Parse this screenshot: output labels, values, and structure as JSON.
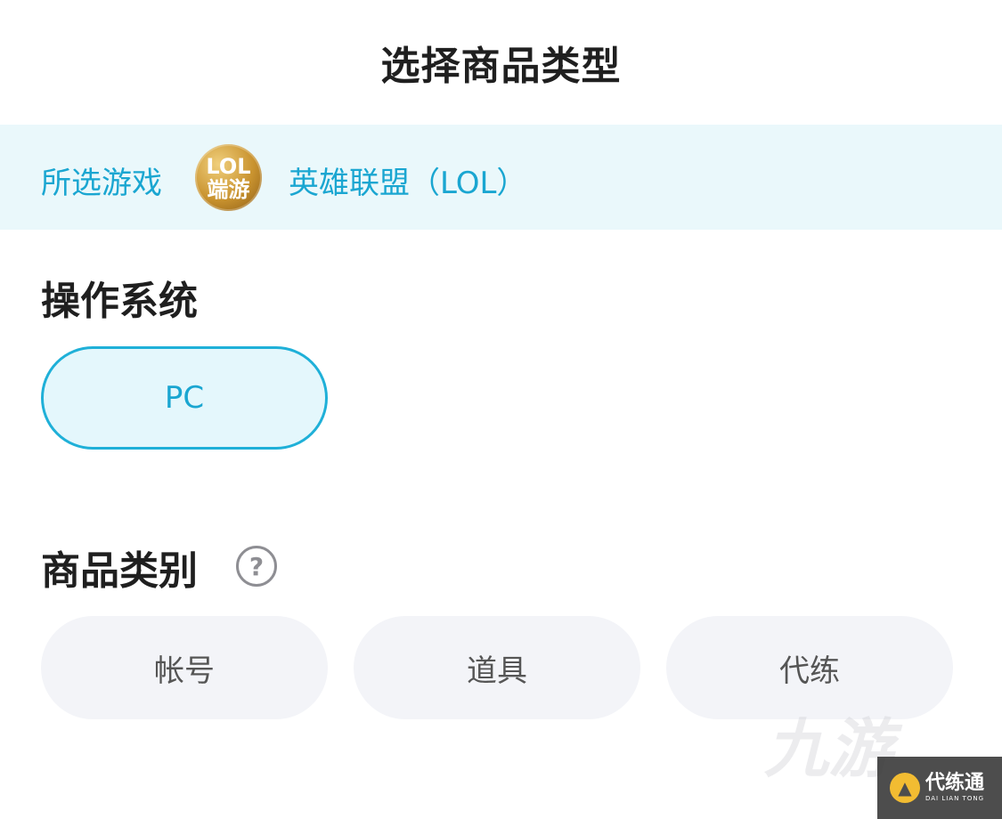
{
  "header": {
    "title": "选择商品类型"
  },
  "game_bar": {
    "label": "所选游戏",
    "logo_line1": "LOL",
    "logo_line2": "端游",
    "game_name": "英雄联盟（LOL）"
  },
  "os_section": {
    "title": "操作系统",
    "options": [
      {
        "label": "PC",
        "selected": true
      }
    ]
  },
  "category_section": {
    "title": "商品类别",
    "help_icon": "question-circle-icon",
    "help_glyph": "?",
    "options": [
      {
        "label": "帐号",
        "selected": false
      },
      {
        "label": "道具",
        "selected": false
      },
      {
        "label": "代练",
        "selected": false
      }
    ]
  },
  "watermark": {
    "ghost_text": "九游",
    "brand_cn": "代练通",
    "brand_en": "DAI LIAN TONG"
  },
  "colors": {
    "accent": "#1aa6d1",
    "accent_border": "#1fb0d8",
    "selected_bg": "#e4f7fc",
    "game_bar_bg": "#eaf8fb",
    "unselected_bg": "#f3f4f8"
  }
}
